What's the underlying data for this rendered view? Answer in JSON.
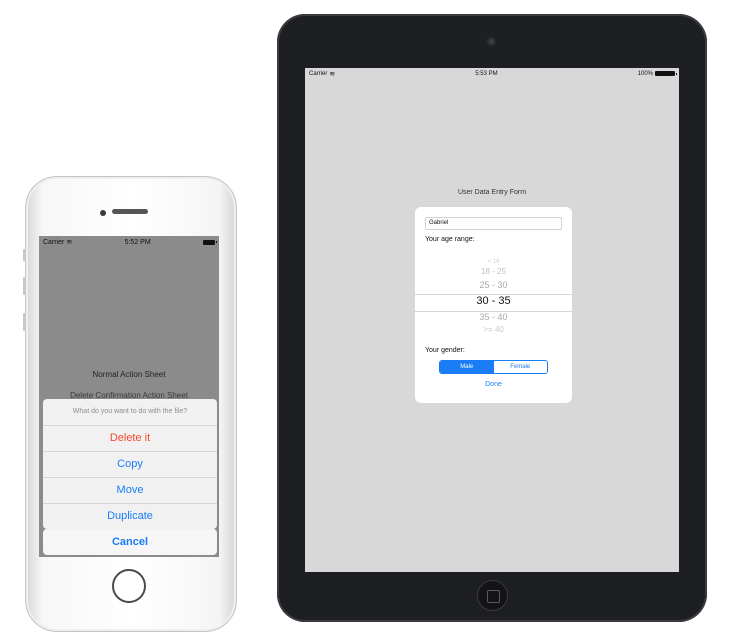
{
  "iphone": {
    "status": {
      "carrier": "Carrier",
      "time": "5:52 PM"
    },
    "background_label": "Normal Action Sheet",
    "background_label_2": "Delete Confirmation Action Sheet",
    "action_sheet": {
      "title": "What do you want to do with the file?",
      "items": [
        {
          "label": "Delete it",
          "style": "destructive"
        },
        {
          "label": "Copy",
          "style": "default"
        },
        {
          "label": "Move",
          "style": "default"
        },
        {
          "label": "Duplicate",
          "style": "default"
        }
      ],
      "cancel_label": "Cancel"
    }
  },
  "ipad": {
    "status": {
      "carrier": "Carrier",
      "time": "5:53 PM",
      "battery": "100%"
    },
    "form_title": "User Data Entry Form",
    "popover": {
      "name_value": "Gabriel",
      "age_label": "Your age range:",
      "age_options": [
        "< 18",
        "18 - 25",
        "25 - 30",
        "30 - 35",
        "35 - 40",
        ">= 40"
      ],
      "age_selected": "30 - 35",
      "gender_label": "Your gender:",
      "gender_options": [
        "Male",
        "Female"
      ],
      "gender_selected": "Male",
      "done_label": "Done"
    }
  },
  "colors": {
    "accent": "#1a7df5",
    "destructive": "#f24c2a",
    "dim_overlay": "#8b8b8b",
    "ipad_background": "#d8d8d8"
  }
}
